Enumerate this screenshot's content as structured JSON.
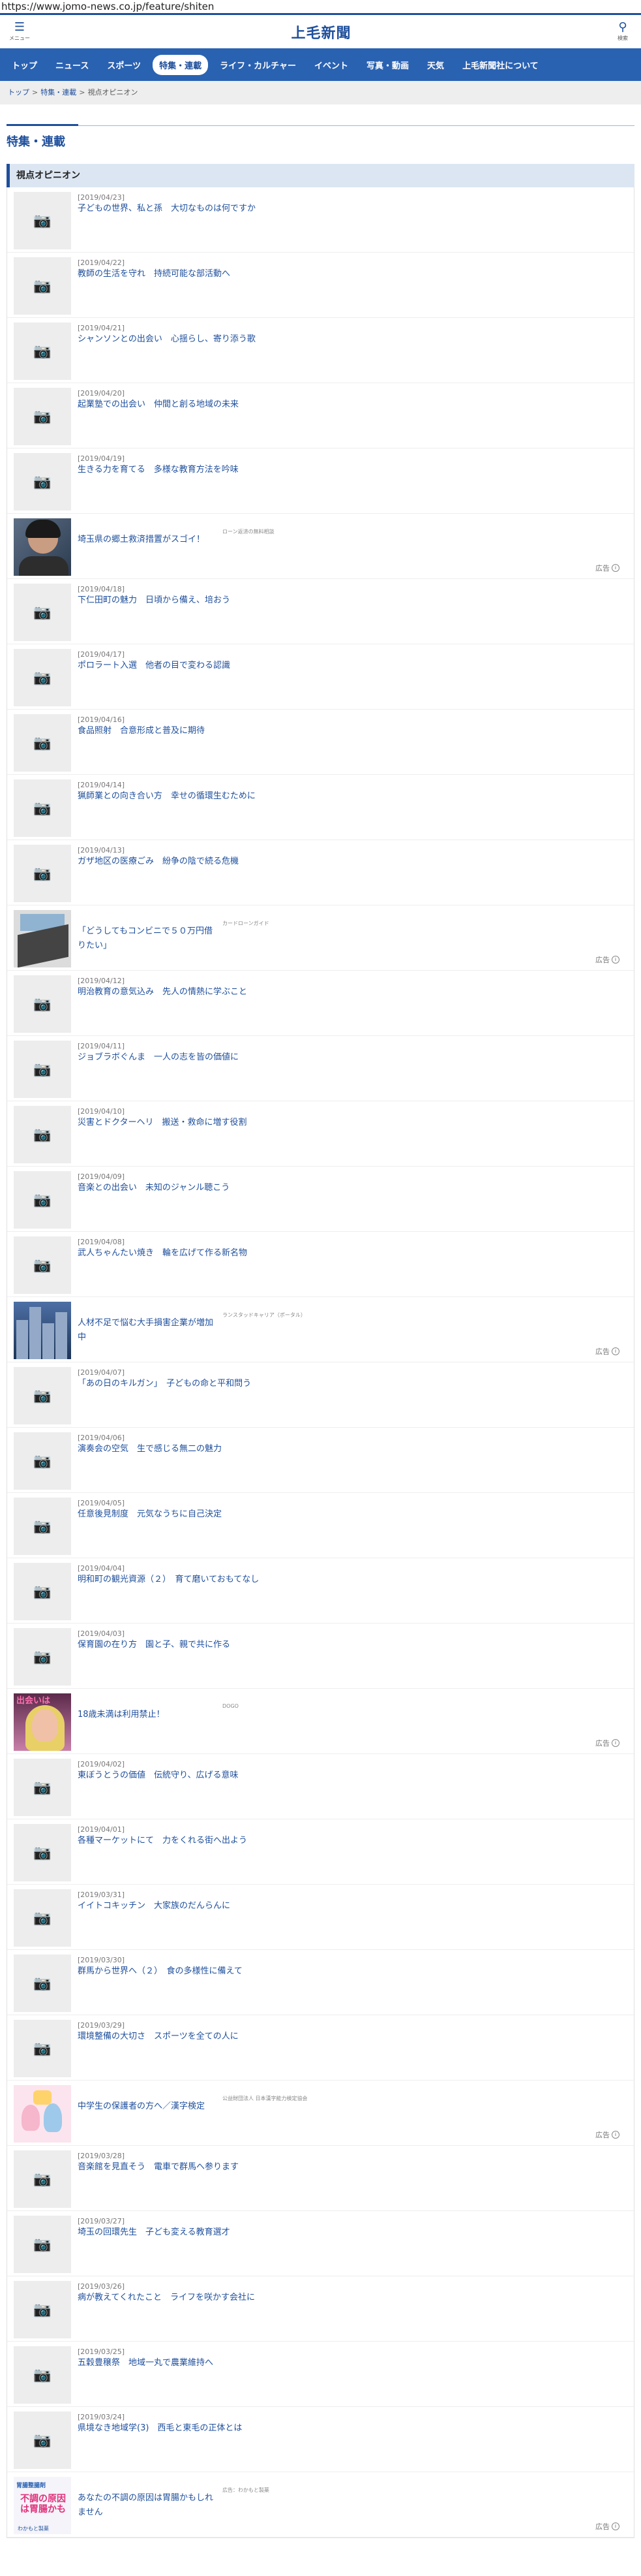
{
  "browser": {
    "url": "https://www.jomo-news.co.jp/feature/shiten"
  },
  "header": {
    "menu_glyph": "☰",
    "menu_label": "メニュー",
    "logo": "上毛新聞",
    "search_glyph": "⚲",
    "search_label": "検索"
  },
  "nav": {
    "items": [
      {
        "label": "トップ"
      },
      {
        "label": "ニュース"
      },
      {
        "label": "スポーツ"
      },
      {
        "label": "特集・連載",
        "active": true
      },
      {
        "label": "ライフ・カルチャー"
      },
      {
        "label": "イベント"
      },
      {
        "label": "写真・動画"
      },
      {
        "label": "天気"
      },
      {
        "label": "上毛新聞社について"
      }
    ]
  },
  "breadcrumb": {
    "items": [
      "トップ",
      "特集・連載",
      "視点オピニオン"
    ],
    "separator": ">"
  },
  "page": {
    "title": "特集・連載"
  },
  "section": {
    "title": "視点オピニオン"
  },
  "placeholder_icon": "camera-icon",
  "ad_label": "広告",
  "articles": [
    {
      "date": "[2019/04/23]",
      "title": "子どもの世界、私と孫　大切なものは何ですか"
    },
    {
      "date": "[2019/04/22]",
      "title": "教師の生活を守れ　持続可能な部活動へ"
    },
    {
      "date": "[2019/04/21]",
      "title": "シャンソンとの出会い　心揺らし、寄り添う歌"
    },
    {
      "date": "[2019/04/20]",
      "title": "起業塾での出会い　仲間と創る地域の未来"
    },
    {
      "date": "[2019/04/19]",
      "title": "生きる力を育てる　多様な教育方法を吟味"
    },
    {
      "ad": true,
      "title": "埼玉県の郷土救済措置がスゴイ！",
      "source": "ローン返済の無料相談"
    },
    {
      "date": "[2019/04/18]",
      "title": "下仁田町の魅力　日頃から備え、培おう"
    },
    {
      "date": "[2019/04/17]",
      "title": "ポロラート入選　他者の目で変わる認識"
    },
    {
      "date": "[2019/04/16]",
      "title": "食品照射　合意形成と普及に期待"
    },
    {
      "date": "[2019/04/14]",
      "title": "猟師業との向き合い方　幸せの循環生むために"
    },
    {
      "date": "[2019/04/13]",
      "title": "ガザ地区の医療ごみ　紛争の陰で続る危機"
    },
    {
      "ad": true,
      "title": "「どうしてもコンビニで５０万円借りたい」",
      "source": "カードローンガイド"
    },
    {
      "date": "[2019/04/12]",
      "title": "明治教育の意気込み　先人の情熱に学ぶこと"
    },
    {
      "date": "[2019/04/11]",
      "title": "ジョブラボぐんま　一人の志を皆の価値に"
    },
    {
      "date": "[2019/04/10]",
      "title": "災害とドクターヘリ　搬送・救命に増す役割"
    },
    {
      "date": "[2019/04/09]",
      "title": "音楽との出会い　未知のジャンル聴こう"
    },
    {
      "date": "[2019/04/08]",
      "title": "武人ちゃんたい焼き　輪を広げて作る新名物"
    },
    {
      "ad": true,
      "title": "人材不足で悩む大手損害企業が増加中",
      "source": "ランスタッドキャリア（ポータル）"
    },
    {
      "date": "[2019/04/07]",
      "title": "「あの日のキルガン」　子どもの命と平和問う"
    },
    {
      "date": "[2019/04/06]",
      "title": "演奏会の空気　生で感じる無二の魅力"
    },
    {
      "date": "[2019/04/05]",
      "title": "任意後見制度　元気なうちに自己決定"
    },
    {
      "date": "[2019/04/04]",
      "title": "明和町の観光資源（２）　育て磨いておもてなし"
    },
    {
      "date": "[2019/04/03]",
      "title": "保育園の在り方　園と子、親で共に作る"
    },
    {
      "ad": true,
      "title": "18歳未満は利用禁止！",
      "source": "DOGO",
      "thumb_text": "出会いは"
    },
    {
      "date": "[2019/04/02]",
      "title": "東ぼうとうの価値　伝統守り、広げる意味"
    },
    {
      "date": "[2019/04/01]",
      "title": "各種マーケットにて　力をくれる街へ出よう"
    },
    {
      "date": "[2019/03/31]",
      "title": "イイトコキッチン　大家族のだんらんに"
    },
    {
      "date": "[2019/03/30]",
      "title": "群馬から世界へ（２）　食の多様性に備えて"
    },
    {
      "date": "[2019/03/29]",
      "title": "環境整備の大切さ　スポーツを全ての人に"
    },
    {
      "ad": true,
      "title": "中学生の保護者の方へ／漢字検定",
      "source": "公益財団法人 日本漢字能力検定協会"
    },
    {
      "date": "[2019/03/28]",
      "title": "音楽館を見直そう　電車で群馬へ参ります"
    },
    {
      "date": "[2019/03/27]",
      "title": "埼玉の回環先生　子ども変える教育選才"
    },
    {
      "date": "[2019/03/26]",
      "title": "病が教えてくれたこと　ライフを咲かす会社に"
    },
    {
      "date": "[2019/03/25]",
      "title": "五穀豊穣祭　地域一丸で農業維持へ"
    },
    {
      "date": "[2019/03/24]",
      "title": "県境なき地域学(3)　西毛と東毛の正体とは"
    },
    {
      "ad": true,
      "title": "あなたの不調の原因は胃腸かもしれません",
      "source": "広告：わかもと製薬",
      "thumb_texts": [
        "胃腸整腸剤",
        "不調の原因は胃腸かも",
        "わかもと製薬"
      ]
    }
  ]
}
